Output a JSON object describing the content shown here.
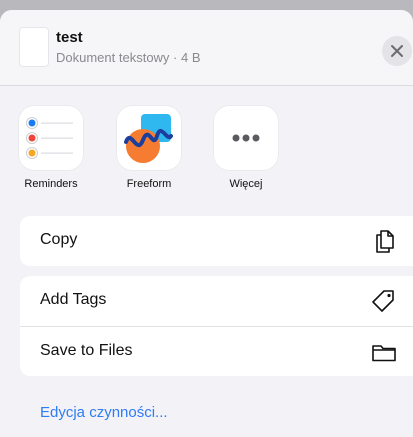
{
  "header": {
    "file_name": "test",
    "file_meta": "Dokument tekstowy · 4 B",
    "close_icon": "close-icon"
  },
  "apps": [
    {
      "label": "Reminders",
      "icon": "reminders-icon"
    },
    {
      "label": "Freeform",
      "icon": "freeform-icon"
    },
    {
      "label": "Więcej",
      "icon": "more-icon"
    }
  ],
  "actions": {
    "copy": {
      "label": "Copy",
      "icon": "copy-icon"
    },
    "add_tags": {
      "label": "Add Tags",
      "icon": "tag-icon"
    },
    "save_to_files": {
      "label": "Save to Files",
      "icon": "folder-icon"
    }
  },
  "footer": {
    "edit_actions": "Edycja czynności..."
  },
  "colors": {
    "accent": "#2f7cf6",
    "sheet_background": "#f2f2f7",
    "reminder_blue": "#1a7cf5",
    "reminder_red": "#f0453a",
    "reminder_orange": "#f5a623"
  }
}
